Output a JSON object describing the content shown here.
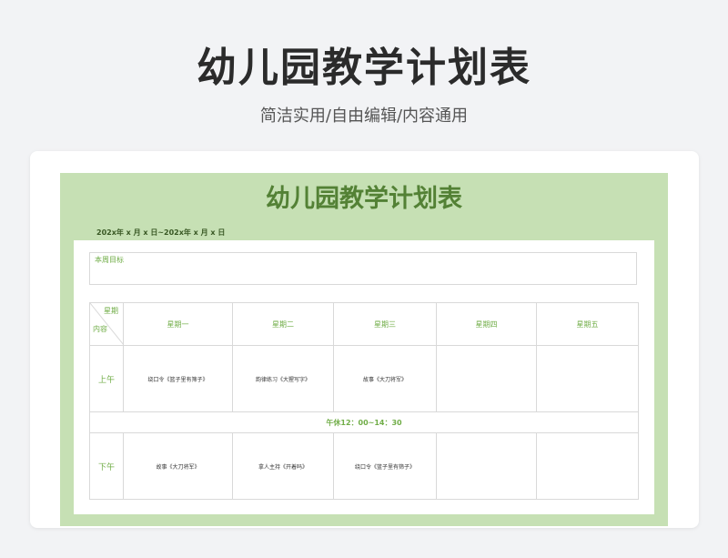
{
  "header": {
    "title": "幼儿园教学计划表",
    "subtitle": "简洁实用/自由编辑/内容通用"
  },
  "sheet": {
    "title": "幼儿园教学计划表",
    "date_range": "202x年  x 月 x 日~202x年 x 月 x 日",
    "goal_label": "本周目标",
    "corner_top": "星期",
    "corner_bottom": "内容",
    "days": [
      "星期一",
      "星期二",
      "星期三",
      "星期四",
      "星期五"
    ],
    "morning": {
      "label": "上午",
      "cells": [
        "绕口令《篮子里有筛子》",
        "韵律练习《大猩写字》",
        "故事《大刀将军》",
        "",
        ""
      ]
    },
    "break_text": "午休12：00~14：30",
    "afternoon": {
      "label": "下午",
      "cells": [
        "故事《大刀将军》",
        "拿人主持《开着吗》",
        "绕口令《篮子里有筛子》",
        "",
        ""
      ]
    }
  },
  "colors": {
    "sheet_background": "#c6e0b4",
    "accent_green": "#70ad47",
    "title_green": "#538135"
  }
}
